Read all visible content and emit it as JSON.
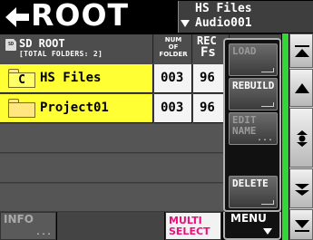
{
  "header": {
    "title": "ROOT",
    "info_line1": "HS Files",
    "info_line2": "Audio001"
  },
  "table": {
    "sd_root_label": "SD ROOT",
    "total_folders_label": "[TOTAL FOLDERS: 2]",
    "num_folder_label_1": "NUM",
    "num_folder_label_2": "OF",
    "num_folder_label_3": "FOLDER",
    "rec_fs_label_1": "REC",
    "rec_fs_label_2": "Fs",
    "rows": [
      {
        "folder_mark": "C",
        "name": "HS Files",
        "num_folder": "003",
        "fs": "96"
      },
      {
        "folder_mark": "",
        "name": "Project01",
        "num_folder": "003",
        "fs": "96"
      }
    ]
  },
  "bottom": {
    "info_label": "INFO",
    "info_dots": "...",
    "multi_label_1": "MULTI",
    "multi_label_2": "SELECT"
  },
  "popup": {
    "load_label": "LOAD",
    "rebuild_label": "REBUILD",
    "edit_label_1": "EDIT",
    "edit_label_2": "NAME",
    "edit_dots": "...",
    "delete_label": "DELETE",
    "menu_label": "MENU"
  },
  "colors": {
    "selected_row": "#ffff33",
    "scroll_thumb": "#37d437",
    "multi_select_text": "#e8127a"
  },
  "icons": {
    "back": "back-arrow-icon",
    "sd_card": "sd-card-icon",
    "folder": "folder-icon",
    "scroll_top": "scroll-top-icon",
    "scroll_up": "scroll-up-icon",
    "scroll_position": "scroll-position-icon",
    "scroll_down": "scroll-down-icon",
    "scroll_bottom": "scroll-bottom-icon"
  }
}
